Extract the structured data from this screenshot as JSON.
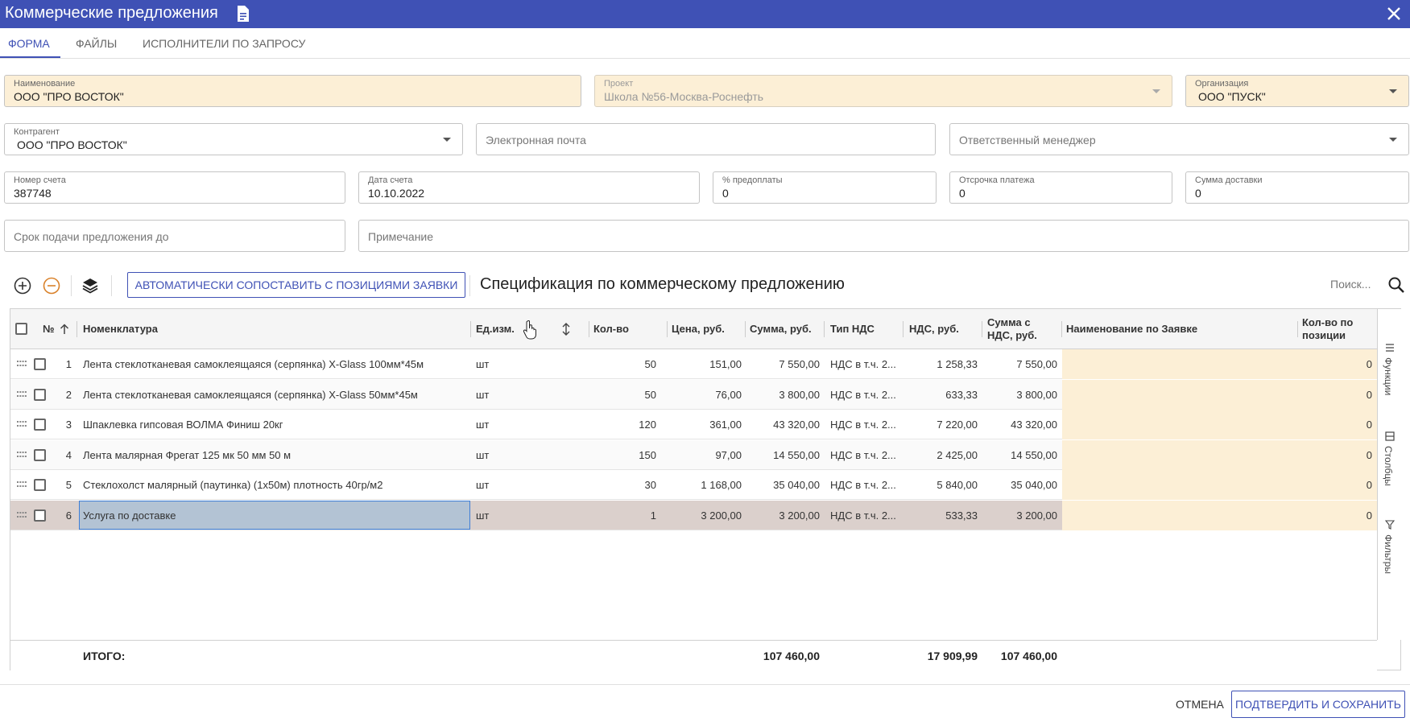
{
  "window": {
    "title": "Коммерческие предложения"
  },
  "tabs": [
    {
      "label": "ФОРМА",
      "active": true
    },
    {
      "label": "ФАЙЛЫ",
      "active": false
    },
    {
      "label": "ИСПОЛНИТЕЛИ ПО ЗАПРОСУ",
      "active": false
    }
  ],
  "form": {
    "name": {
      "label": "Наименование",
      "value": "ООО \"ПРО ВОСТОК\""
    },
    "project": {
      "label": "Проект",
      "value": "Школа №56-Москва-Роснефть"
    },
    "organization": {
      "label": "Организация",
      "value": "ООО \"ПУСК\""
    },
    "counterparty": {
      "label": "Контрагент",
      "value": "ООО \"ПРО ВОСТОК\""
    },
    "email": {
      "placeholder": "Электронная почта"
    },
    "manager": {
      "placeholder": "Ответственный менеджер"
    },
    "invoice_number": {
      "label": "Номер счета",
      "value": "387748"
    },
    "invoice_date": {
      "label": "Дата счета",
      "value": "10.10.2022"
    },
    "prepayment": {
      "label": "% предоплаты",
      "value": "0"
    },
    "deferral": {
      "label": "Отсрочка платежа",
      "value": "0"
    },
    "delivery_sum": {
      "label": "Сумма доставки",
      "value": "0"
    },
    "deadline": {
      "placeholder": "Срок подачи предложения до"
    },
    "note": {
      "placeholder": "Примечание"
    }
  },
  "toolbar": {
    "auto_match_label": "АВТОМАТИЧЕСКИ СОПОСТАВИТЬ С ПОЗИЦИЯМИ ЗАЯВКИ",
    "spec_title": "Спецификация по коммерческому предложению",
    "search_placeholder": "Поиск..."
  },
  "grid": {
    "headers": {
      "num": "№",
      "nomenclature": "Номенклатура",
      "unit": "Ед.изм.",
      "qty": "Кол-во",
      "price": "Цена, руб.",
      "sum": "Сумма, руб.",
      "vat_type": "Тип НДС",
      "vat": "НДС, руб.",
      "sum_vat": "Сумма с НДС, руб.",
      "req_name": "Наименование по Заявке",
      "qty_pos": "Кол-во по позиции"
    },
    "rows": [
      {
        "num": "1",
        "name": "Лента стеклотканевая самоклеящаяся (серпянка) X-Glass 100мм*45м",
        "unit": "шт",
        "qty": "50",
        "price": "151,00",
        "sum": "7 550,00",
        "vat_type": "НДС в т.ч. 2...",
        "vat": "1 258,33",
        "sum_vat": "7 550,00",
        "req_name": "",
        "qty_pos": "0"
      },
      {
        "num": "2",
        "name": "Лента стеклотканевая самоклеящаяся (серпянка) X-Glass 50мм*45м",
        "unit": "шт",
        "qty": "50",
        "price": "76,00",
        "sum": "3 800,00",
        "vat_type": "НДС в т.ч. 2...",
        "vat": "633,33",
        "sum_vat": "3 800,00",
        "req_name": "",
        "qty_pos": "0"
      },
      {
        "num": "3",
        "name": "Шпаклевка гипсовая ВОЛМА Финиш 20кг",
        "unit": "шт",
        "qty": "120",
        "price": "361,00",
        "sum": "43 320,00",
        "vat_type": "НДС в т.ч. 2...",
        "vat": "7 220,00",
        "sum_vat": "43 320,00",
        "req_name": "",
        "qty_pos": "0"
      },
      {
        "num": "4",
        "name": "Лента малярная Фрегат 125 мк 50 мм 50 м",
        "unit": "шт",
        "qty": "150",
        "price": "97,00",
        "sum": "14 550,00",
        "vat_type": "НДС в т.ч. 2...",
        "vat": "2 425,00",
        "sum_vat": "14 550,00",
        "req_name": "",
        "qty_pos": "0"
      },
      {
        "num": "5",
        "name": "Стеклохолст малярный (паутинка) (1х50м) плотность 40гр/м2",
        "unit": "шт",
        "qty": "30",
        "price": "1 168,00",
        "sum": "35 040,00",
        "vat_type": "НДС в т.ч. 2...",
        "vat": "5 840,00",
        "sum_vat": "35 040,00",
        "req_name": "",
        "qty_pos": "0"
      },
      {
        "num": "6",
        "name": "Услуга по доставке",
        "unit": "шт",
        "qty": "1",
        "price": "3 200,00",
        "sum": "3 200,00",
        "vat_type": "НДС в т.ч. 2...",
        "vat": "533,33",
        "sum_vat": "3 200,00",
        "req_name": "",
        "qty_pos": "0"
      }
    ],
    "footer": {
      "label": "ИТОГО:",
      "sum": "107 460,00",
      "vat": "17 909,99",
      "sum_vat": "107 460,00"
    },
    "sidebar": {
      "functions": "Функции",
      "columns": "Столбцы",
      "filters": "Фильтры"
    }
  },
  "actions": {
    "cancel": "ОТМЕНА",
    "confirm": "ПОДТВЕРДИТЬ И СОХРАНИТЬ"
  },
  "colors": {
    "primary": "#3f51b5",
    "highlight": "#fcefd6",
    "selected_row": "#dbd0cc"
  }
}
